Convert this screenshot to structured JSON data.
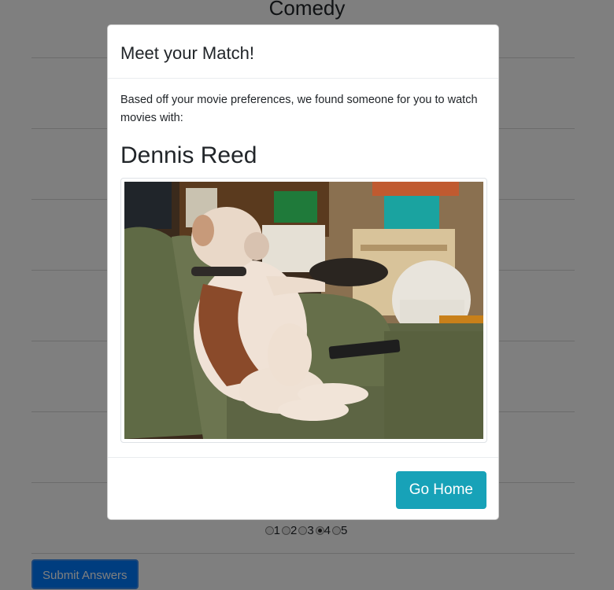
{
  "survey": {
    "heading": "Comedy",
    "ratings": [
      "1",
      "2",
      "3",
      "4",
      "5"
    ],
    "selected_rating": "4",
    "submit_label": "Submit Answers"
  },
  "modal": {
    "title": "Meet your Match!",
    "message": "Based off your movie preferences, we found someone for you to watch movies with:",
    "match_name": "Dennis Reed",
    "image_subject": "bulldog-sitting-on-couch",
    "footer_button_label": "Go Home"
  },
  "colors": {
    "primary": "#007bff",
    "info": "#17a2b8",
    "backdrop": "rgba(0,0,0,0.5)"
  }
}
